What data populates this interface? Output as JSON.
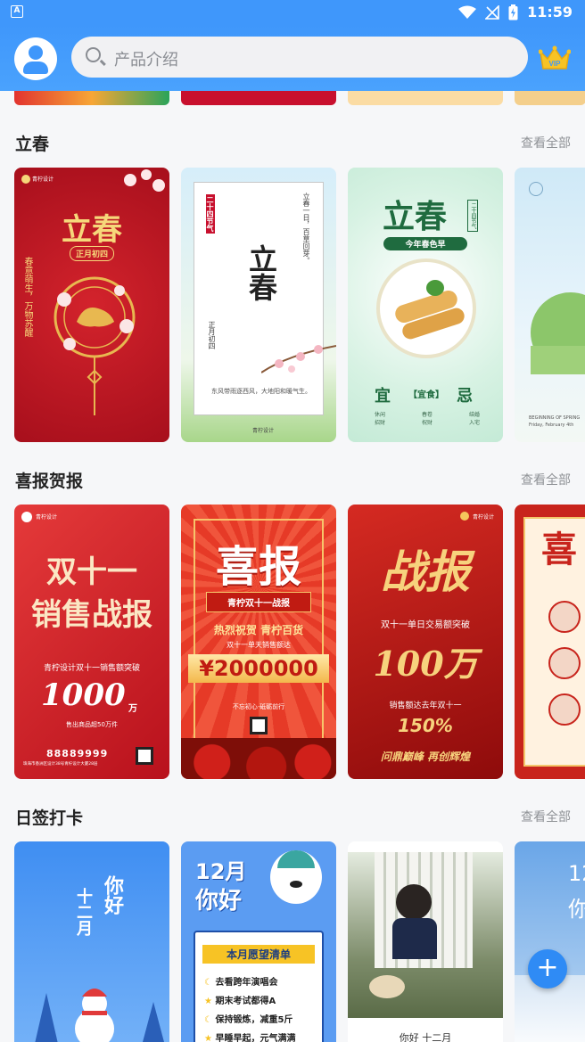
{
  "status_bar": {
    "time": "11:59",
    "sim_label": "A"
  },
  "header": {
    "search_placeholder": "产品介绍",
    "vip_label": "VIP"
  },
  "sections": [
    {
      "title": "立春",
      "more_label": "查看全部",
      "cards": [
        {
          "main": "立春",
          "sub": "正月初四",
          "side": "春意萌生，万物苏醒",
          "logo": "青柠设计"
        },
        {
          "main": "立春",
          "tag": "二十四节气",
          "side": "立春一日，百草回芽。",
          "date": "正月初四",
          "poem": "东风带雨逐西风，大地阳和暖气生。",
          "logo": "青柠设计"
        },
        {
          "main": "立春",
          "tag": "二十四节气",
          "sub": "今年春色早",
          "left": "宜",
          "mid": "【宜食】",
          "right": "忌",
          "items": [
            "休闲",
            "春卷",
            "结婚"
          ],
          "items2": [
            "招财",
            "祝财",
            "入宅"
          ]
        },
        {
          "tiny": "BEGINNING OF SPRING",
          "tiny2": "Friday, February 4th"
        }
      ]
    },
    {
      "title": "喜报贺报",
      "more_label": "查看全部",
      "cards": [
        {
          "main1": "双十一",
          "main2": "销售战报",
          "line": "青柠设计双十一销售额突破",
          "num": "1000",
          "unit": "万",
          "small": "售出商品超50万件",
          "logo": "青柠设计",
          "phone": "88889999",
          "addr": "珠海市香洲区设计38号青柠设计大厦28层"
        },
        {
          "main": "喜报",
          "banner": "青柠双十一战报",
          "line1": "热烈祝贺 青柠百货",
          "line2": "双十一单天销售额达",
          "num": "¥2000000",
          "foot": "不忘初心·砥砺前行"
        },
        {
          "main": "战报",
          "line": "双十一单日交易额突破",
          "num": "100万",
          "line2": "销售额达去年双十一",
          "pct": "150%",
          "foot": "问鼎巅峰  再创辉煌",
          "logo": "青柠设计"
        },
        {
          "main": "喜"
        }
      ]
    },
    {
      "title": "日签打卡",
      "more_label": "查看全部",
      "cards": [
        {
          "main": "你好",
          "sub": "十二月"
        },
        {
          "main1": "12月",
          "main2": "你好",
          "banner": "本月愿望清单",
          "items": [
            "去看跨年演唱会",
            "期末考试都得A",
            "保持锻炼，减重5斤",
            "早睡早起，元气满满"
          ]
        },
        {
          "caption": "你好  十二月"
        },
        {
          "main": "12",
          "sub": "你"
        }
      ]
    }
  ],
  "colors": {
    "accent": "#3f97fb",
    "red": "#c8102e",
    "fab": "#2f8bf5"
  },
  "fab_label": "+"
}
